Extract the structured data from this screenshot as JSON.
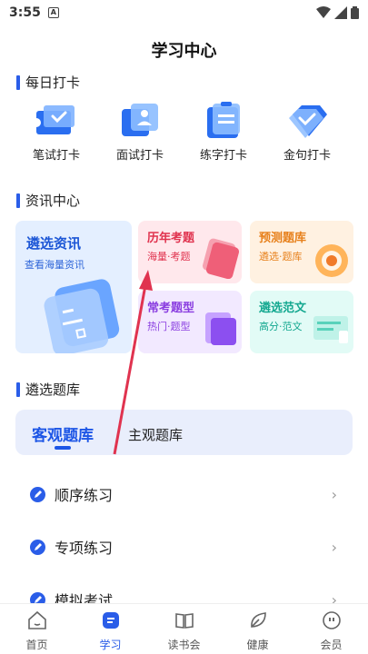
{
  "status": {
    "time": "3:55",
    "notif_icon": "A"
  },
  "page_title": "学习中心",
  "daily": {
    "title": "每日打卡",
    "items": [
      {
        "label": "笔试打卡",
        "icon": "ticket-icon"
      },
      {
        "label": "面试打卡",
        "icon": "person-card-icon"
      },
      {
        "label": "练字打卡",
        "icon": "clipboard-icon"
      },
      {
        "label": "金句打卡",
        "icon": "diamond-icon"
      }
    ]
  },
  "news": {
    "title": "资讯中心",
    "big": {
      "title": "遴选资讯",
      "sub": "查看海量资讯"
    },
    "cards": [
      {
        "title": "历年考题",
        "sub": "海量·考题"
      },
      {
        "title": "预测题库",
        "sub": "遴选·题库"
      },
      {
        "title": "常考题型",
        "sub": "热门·题型"
      },
      {
        "title": "遴选范文",
        "sub": "高分·范文"
      }
    ]
  },
  "bank": {
    "title": "遴选题库",
    "tab_active": "客观题库",
    "tab_other": "主观题库",
    "items": [
      {
        "label": "顺序练习"
      },
      {
        "label": "专项练习"
      },
      {
        "label": "模拟考试"
      }
    ]
  },
  "nav": [
    {
      "label": "首页",
      "icon": "home-icon"
    },
    {
      "label": "学习",
      "icon": "study-icon"
    },
    {
      "label": "读书会",
      "icon": "book-icon"
    },
    {
      "label": "健康",
      "icon": "leaf-icon"
    },
    {
      "label": "会员",
      "icon": "member-icon"
    }
  ],
  "colors": {
    "accent": "#2a5de8",
    "annotation_arrow": "#e0334f"
  }
}
